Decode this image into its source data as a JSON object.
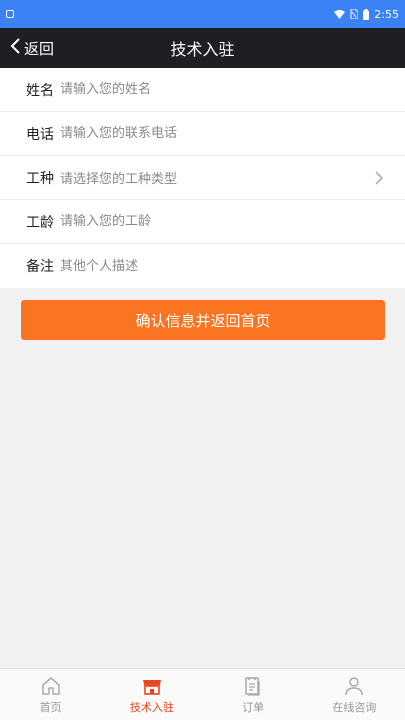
{
  "status_bar": {
    "time": "2:55",
    "bg_color": "#3b82f6",
    "icons": [
      "app-notification-icon",
      "wifi-icon",
      "no-sim-icon",
      "battery-icon"
    ]
  },
  "navbar": {
    "back_label": "返回",
    "title": "技术入驻"
  },
  "form": {
    "rows": [
      {
        "label": "姓名",
        "placeholder": "请输入您的姓名",
        "type": "input"
      },
      {
        "label": "电话",
        "placeholder": "请输入您的联系电话",
        "type": "input"
      },
      {
        "label": "工种",
        "placeholder": "请选择您的工种类型",
        "type": "select"
      },
      {
        "label": "工龄",
        "placeholder": "请输入您的工龄",
        "type": "input"
      },
      {
        "label": "备注",
        "placeholder": "其他个人描述",
        "type": "input"
      }
    ]
  },
  "confirm_button": {
    "label": "确认信息并返回首页",
    "color": "#fb7421"
  },
  "tabbar": {
    "active_color": "#e8461f",
    "tabs": [
      {
        "label": "首页",
        "icon": "home-icon",
        "active": false
      },
      {
        "label": "技术入驻",
        "icon": "storefront-icon",
        "active": true
      },
      {
        "label": "订单",
        "icon": "order-list-icon",
        "active": false
      },
      {
        "label": "在线咨询",
        "icon": "person-icon",
        "active": false
      }
    ]
  }
}
